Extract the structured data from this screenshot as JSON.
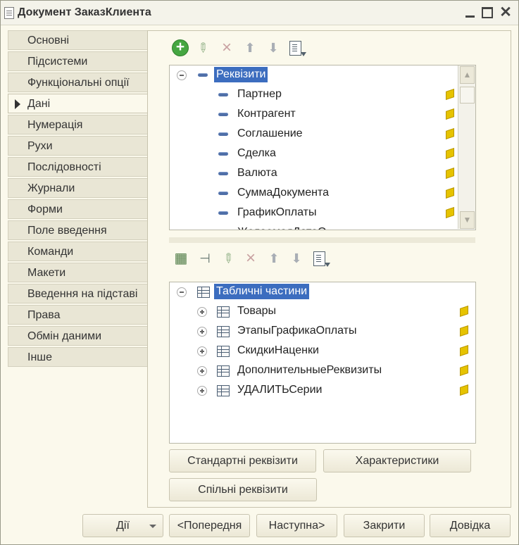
{
  "window": {
    "title": "Документ ЗаказКлиента"
  },
  "sidebar": {
    "items": [
      {
        "label": "Основні"
      },
      {
        "label": "Підсистеми"
      },
      {
        "label": "Функціональні опції"
      },
      {
        "label": "Дані"
      },
      {
        "label": "Нумерація"
      },
      {
        "label": "Рухи"
      },
      {
        "label": "Послідовності"
      },
      {
        "label": "Журнали"
      },
      {
        "label": "Форми"
      },
      {
        "label": "Поле введення"
      },
      {
        "label": "Команди"
      },
      {
        "label": "Макети"
      },
      {
        "label": "Введення на підставі"
      },
      {
        "label": "Права"
      },
      {
        "label": "Обмін даними"
      },
      {
        "label": "Інше"
      }
    ],
    "active_index": 3
  },
  "attributes": {
    "root": "Реквізити",
    "items": [
      {
        "label": "Партнер"
      },
      {
        "label": "Контрагент"
      },
      {
        "label": "Соглашение"
      },
      {
        "label": "Сделка"
      },
      {
        "label": "Валюта"
      },
      {
        "label": "СуммаДокумента"
      },
      {
        "label": "ГрафикОплаты"
      },
      {
        "label": "ЖелаемаяДатаО"
      }
    ]
  },
  "tabular_parts": {
    "root": "Табличні частини",
    "items": [
      {
        "label": "Товары"
      },
      {
        "label": "ЭтапыГрафикаОплаты"
      },
      {
        "label": "СкидкиНаценки"
      },
      {
        "label": "ДополнительныеРеквизиты"
      },
      {
        "label": "УДАЛИТЬСерии"
      }
    ]
  },
  "buttons": {
    "standard_attributes": "Стандартні реквізити",
    "characteristics": "Характеристики",
    "common_attributes": "Спільні реквізити",
    "actions": "Дії",
    "previous": "<Попередня",
    "next": "Наступна>",
    "close": "Закрити",
    "help": "Довідка"
  },
  "colors": {
    "selection": "#3c6dbf",
    "tab_inactive": "#e9e6d5",
    "background": "#fbf9ec",
    "add_icon": "#45a641"
  }
}
